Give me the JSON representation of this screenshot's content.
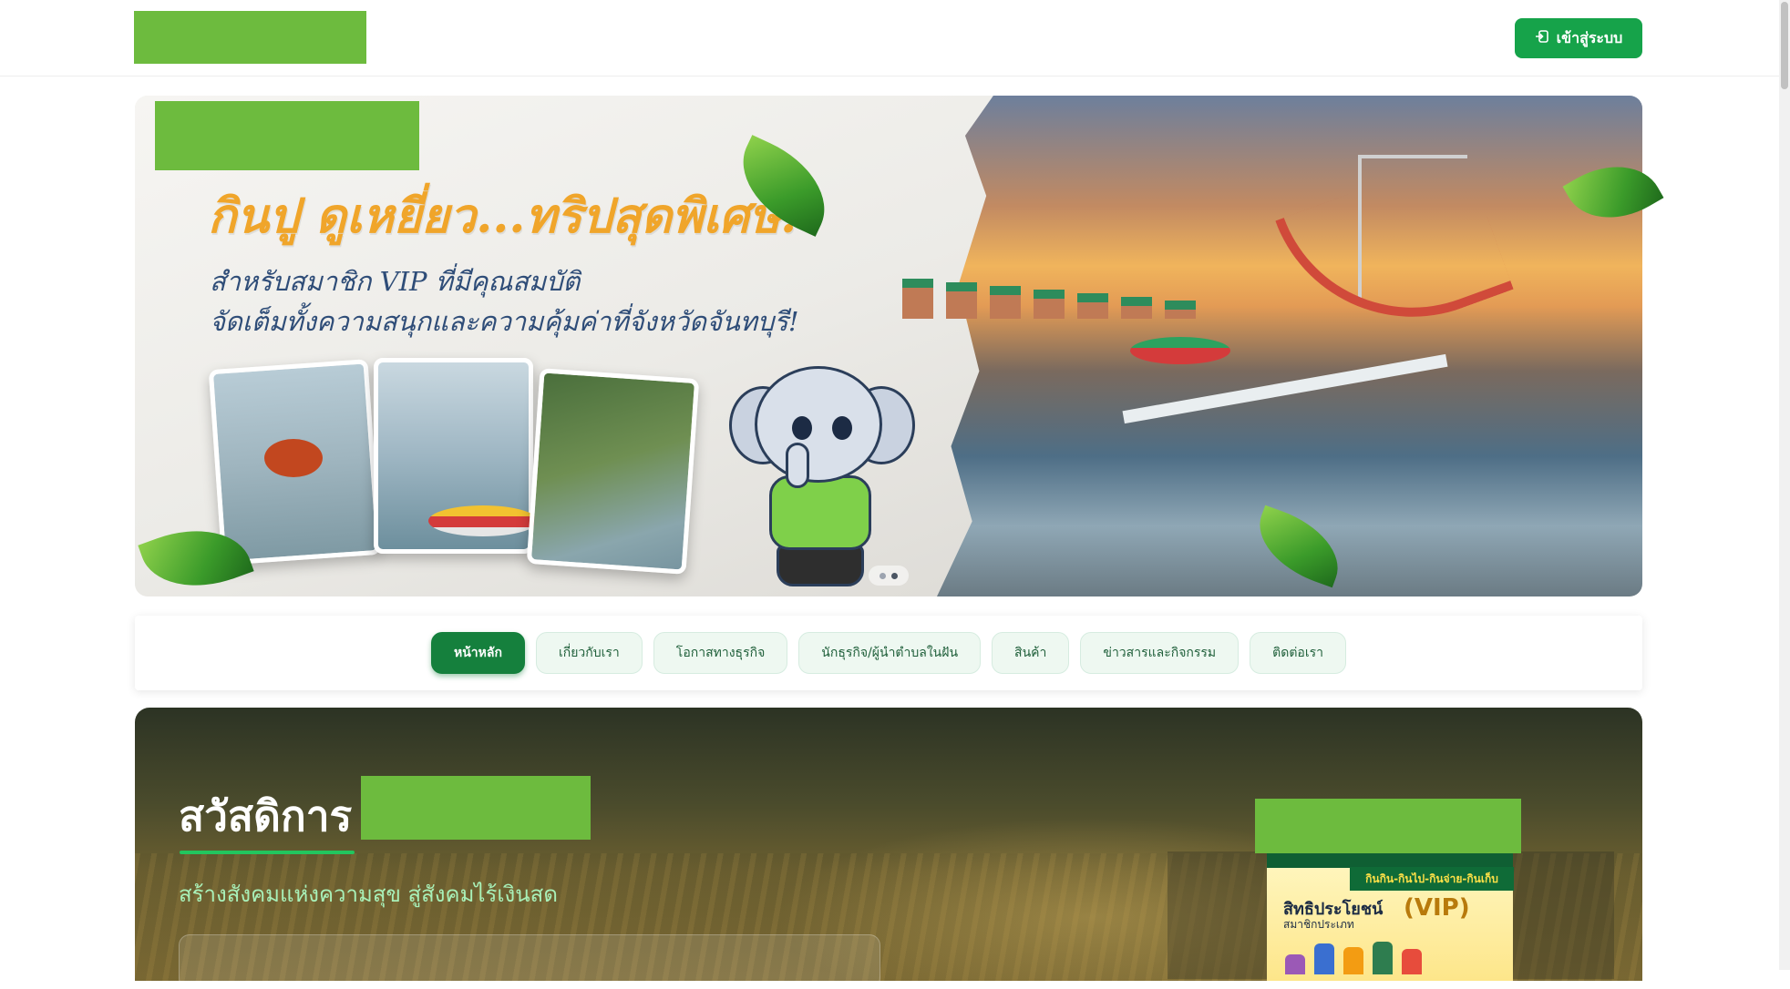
{
  "header": {
    "login_label": "เข้าสู่ระบบ"
  },
  "banner": {
    "title": "กินปู ดูเหยี่ยว...ทริปสุดพิเศษ!",
    "subtitle_line1": "สำหรับสมาชิก VIP ที่มีคุณสมบัติ",
    "subtitle_line2": "จัดเต็มทั้งความสนุกและความคุ้มค่าที่จังหวัดจันทบุรี!",
    "slide_count": 2,
    "active_slide": 2
  },
  "nav": {
    "items": [
      {
        "label": "หน้าหลัก",
        "active": true
      },
      {
        "label": "เกี่ยวกับเรา",
        "active": false
      },
      {
        "label": "โอกาสทางธุรกิจ",
        "active": false
      },
      {
        "label": "นักธุรกิจ/ผู้นำตำบลในฝัน",
        "active": false
      },
      {
        "label": "สินค้า",
        "active": false
      },
      {
        "label": "ข่าวสารและกิจกรรม",
        "active": false
      },
      {
        "label": "ติดต่อเรา",
        "active": false
      }
    ]
  },
  "hero": {
    "title": "สวัสดิการ",
    "subtitle": "สร้างสังคมแห่งความสุข สู่สังคมไร้เงินสด"
  },
  "promo_card": {
    "tag": "กินกิน-กินไป-กินจ่าย-กินเก็บ",
    "heading": "สิทธิประโยชน์",
    "subheading": "สมาชิกประเภท",
    "badge": "(VIP)"
  },
  "colors": {
    "brand_green": "#16a34a",
    "logo_placeholder": "#6dbb3e",
    "nav_active": "#15803d"
  }
}
